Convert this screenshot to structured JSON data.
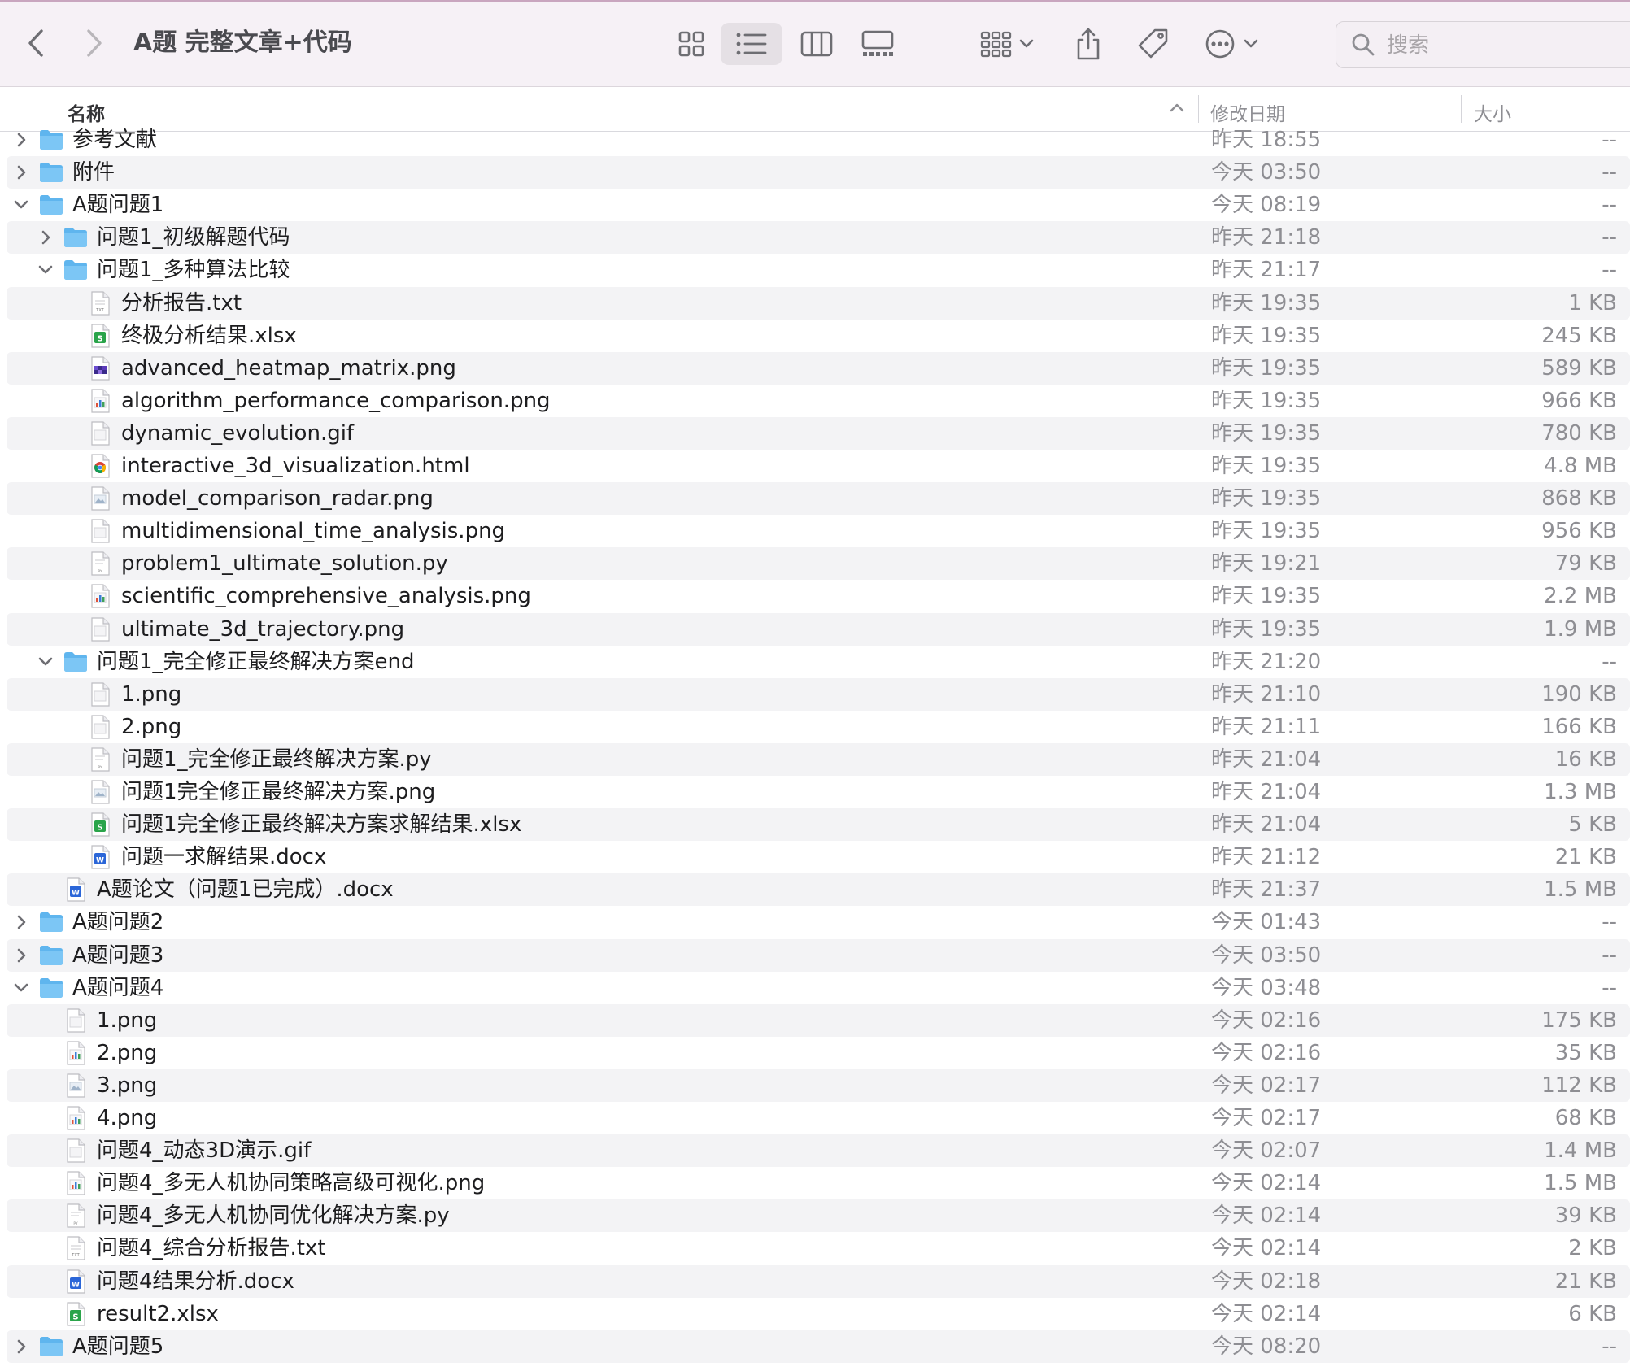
{
  "window": {
    "title": "A题 完整文章+代码"
  },
  "toolbar": {
    "back_icon": "chevron-left-icon",
    "forward_icon": "chevron-right-icon",
    "view_icons_icon": "grid-icon",
    "view_list_icon": "list-icon",
    "view_columns_icon": "columns-icon",
    "view_gallery_icon": "gallery-icon",
    "group_icon": "group-icon",
    "share_icon": "share-icon",
    "tag_icon": "tag-icon",
    "more_icon": "ellipsis-circle-icon",
    "active_view": "list"
  },
  "search": {
    "placeholder": "搜索",
    "value": ""
  },
  "columns": {
    "name": "名称",
    "date": "修改日期",
    "size": "大小",
    "sort": "ascending"
  },
  "colors": {
    "folder": "#5fb5ee",
    "xlsx": "#2aa44a",
    "docx": "#2b66d8",
    "chevron": "#6e6e73",
    "secondary_text": "#8e8e93"
  },
  "files": [
    {
      "name": "参考文献",
      "date": "昨天 18:55",
      "size": "--",
      "depth": 0,
      "kind": "folder",
      "expand": "collapsed"
    },
    {
      "name": "附件",
      "date": "今天 03:50",
      "size": "--",
      "depth": 0,
      "kind": "folder",
      "expand": "collapsed"
    },
    {
      "name": "A题问题1",
      "date": "今天 08:19",
      "size": "--",
      "depth": 0,
      "kind": "folder",
      "expand": "expanded"
    },
    {
      "name": "问题1_初级解题代码",
      "date": "昨天 21:18",
      "size": "--",
      "depth": 1,
      "kind": "folder",
      "expand": "collapsed"
    },
    {
      "name": "问题1_多种算法比较",
      "date": "昨天 21:17",
      "size": "--",
      "depth": 1,
      "kind": "folder",
      "expand": "expanded"
    },
    {
      "name": "分析报告.txt",
      "date": "昨天 19:35",
      "size": "1 KB",
      "depth": 2,
      "kind": "txt"
    },
    {
      "name": "终极分析结果.xlsx",
      "date": "昨天 19:35",
      "size": "245 KB",
      "depth": 2,
      "kind": "xlsx"
    },
    {
      "name": "advanced_heatmap_matrix.png",
      "date": "昨天 19:35",
      "size": "589 KB",
      "depth": 2,
      "kind": "img-heatmap"
    },
    {
      "name": "algorithm_performance_comparison.png",
      "date": "昨天 19:35",
      "size": "966 KB",
      "depth": 2,
      "kind": "img-chart"
    },
    {
      "name": "dynamic_evolution.gif",
      "date": "昨天 19:35",
      "size": "780 KB",
      "depth": 2,
      "kind": "gif"
    },
    {
      "name": "interactive_3d_visualization.html",
      "date": "昨天 19:35",
      "size": "4.8 MB",
      "depth": 2,
      "kind": "html"
    },
    {
      "name": "model_comparison_radar.png",
      "date": "昨天 19:35",
      "size": "868 KB",
      "depth": 2,
      "kind": "img"
    },
    {
      "name": "multidimensional_time_analysis.png",
      "date": "昨天 19:35",
      "size": "956 KB",
      "depth": 2,
      "kind": "img-plain"
    },
    {
      "name": "problem1_ultimate_solution.py",
      "date": "昨天 19:21",
      "size": "79 KB",
      "depth": 2,
      "kind": "py"
    },
    {
      "name": "scientific_comprehensive_analysis.png",
      "date": "昨天 19:35",
      "size": "2.2 MB",
      "depth": 2,
      "kind": "img-chart"
    },
    {
      "name": "ultimate_3d_trajectory.png",
      "date": "昨天 19:35",
      "size": "1.9 MB",
      "depth": 2,
      "kind": "img-plain"
    },
    {
      "name": "问题1_完全修正最终解决方案end",
      "date": "昨天 21:20",
      "size": "--",
      "depth": 1,
      "kind": "folder",
      "expand": "expanded"
    },
    {
      "name": "1.png",
      "date": "昨天 21:10",
      "size": "190 KB",
      "depth": 2,
      "kind": "img-plain"
    },
    {
      "name": "2.png",
      "date": "昨天 21:11",
      "size": "166 KB",
      "depth": 2,
      "kind": "img-plain"
    },
    {
      "name": "问题1_完全修正最终解决方案.py",
      "date": "昨天 21:04",
      "size": "16 KB",
      "depth": 2,
      "kind": "py"
    },
    {
      "name": "问题1完全修正最终解决方案.png",
      "date": "昨天 21:04",
      "size": "1.3 MB",
      "depth": 2,
      "kind": "img"
    },
    {
      "name": "问题1完全修正最终解决方案求解结果.xlsx",
      "date": "昨天 21:04",
      "size": "5 KB",
      "depth": 2,
      "kind": "xlsx"
    },
    {
      "name": "问题一求解结果.docx",
      "date": "昨天 21:12",
      "size": "21 KB",
      "depth": 2,
      "kind": "docx"
    },
    {
      "name": "A题论文（问题1已完成）.docx",
      "date": "昨天 21:37",
      "size": "1.5 MB",
      "depth": 1,
      "kind": "docx"
    },
    {
      "name": "A题问题2",
      "date": "今天 01:43",
      "size": "--",
      "depth": 0,
      "kind": "folder",
      "expand": "collapsed"
    },
    {
      "name": "A题问题3",
      "date": "今天 03:50",
      "size": "--",
      "depth": 0,
      "kind": "folder",
      "expand": "collapsed"
    },
    {
      "name": "A题问题4",
      "date": "今天 03:48",
      "size": "--",
      "depth": 0,
      "kind": "folder",
      "expand": "expanded"
    },
    {
      "name": "1.png",
      "date": "今天 02:16",
      "size": "175 KB",
      "depth": 1,
      "kind": "img-plain"
    },
    {
      "name": "2.png",
      "date": "今天 02:16",
      "size": "35 KB",
      "depth": 1,
      "kind": "img-chart"
    },
    {
      "name": "3.png",
      "date": "今天 02:17",
      "size": "112 KB",
      "depth": 1,
      "kind": "img"
    },
    {
      "name": "4.png",
      "date": "今天 02:17",
      "size": "68 KB",
      "depth": 1,
      "kind": "img-chart"
    },
    {
      "name": "问题4_动态3D演示.gif",
      "date": "今天 02:07",
      "size": "1.4 MB",
      "depth": 1,
      "kind": "gif"
    },
    {
      "name": "问题4_多无人机协同策略高级可视化.png",
      "date": "今天 02:14",
      "size": "1.5 MB",
      "depth": 1,
      "kind": "img-chart"
    },
    {
      "name": "问题4_多无人机协同优化解决方案.py",
      "date": "今天 02:14",
      "size": "39 KB",
      "depth": 1,
      "kind": "py"
    },
    {
      "name": "问题4_综合分析报告.txt",
      "date": "今天 02:14",
      "size": "2 KB",
      "depth": 1,
      "kind": "txt"
    },
    {
      "name": "问题4结果分析.docx",
      "date": "今天 02:18",
      "size": "21 KB",
      "depth": 1,
      "kind": "docx"
    },
    {
      "name": "result2.xlsx",
      "date": "今天 02:14",
      "size": "6 KB",
      "depth": 1,
      "kind": "xlsx"
    },
    {
      "name": "A题问题5",
      "date": "今天 08:20",
      "size": "--",
      "depth": 0,
      "kind": "folder",
      "expand": "collapsed"
    }
  ]
}
